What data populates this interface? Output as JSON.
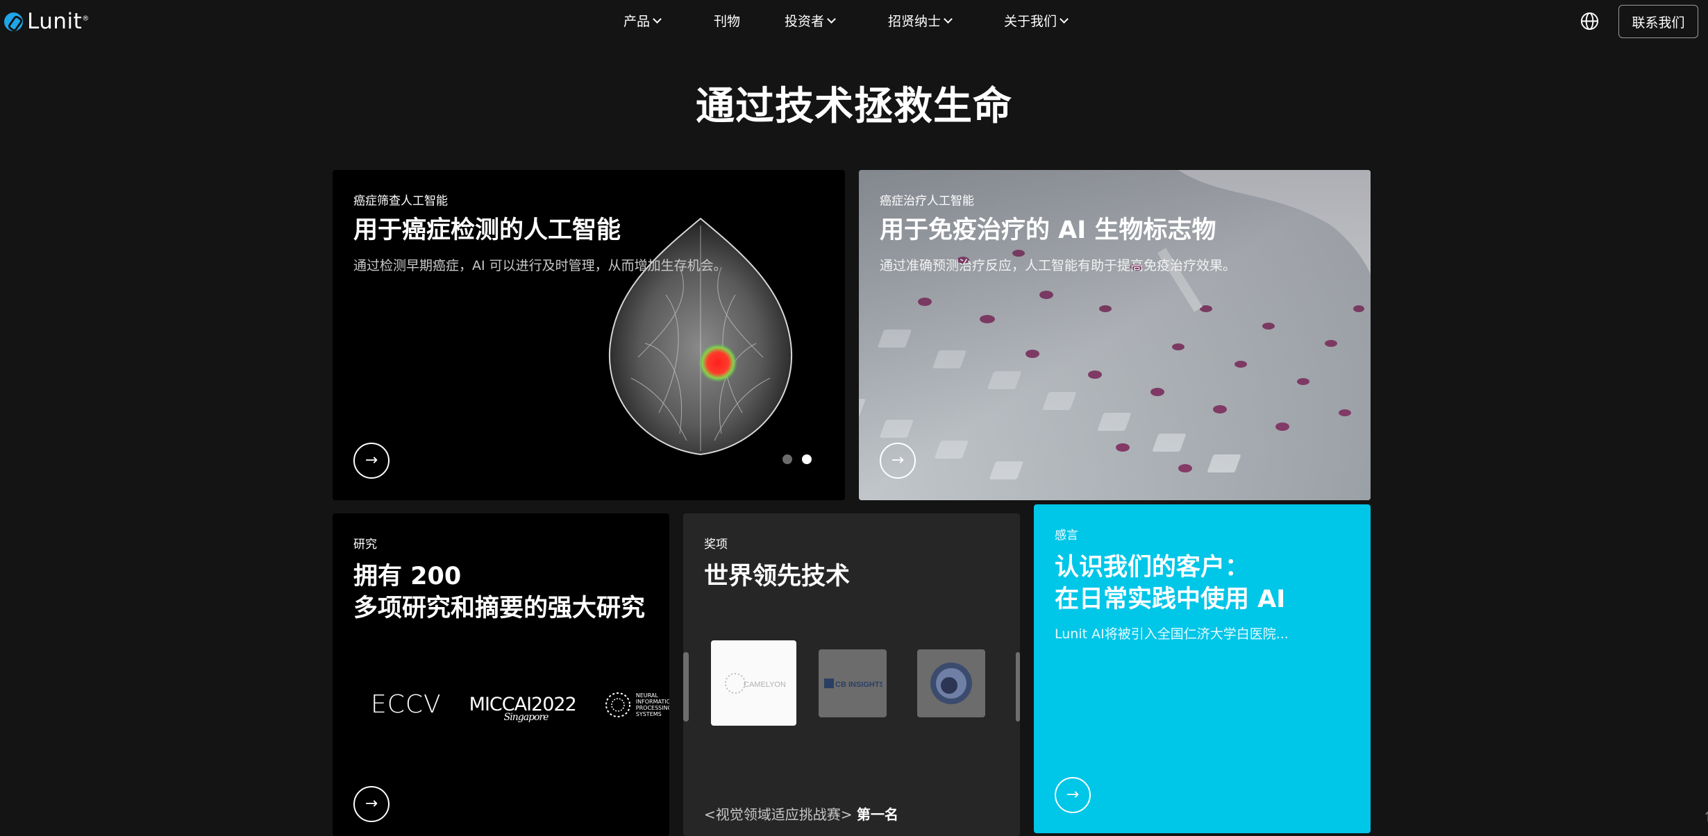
{
  "nav": {
    "logo_text": "Lunit",
    "logo_mark": "®",
    "menu": [
      {
        "label": "产品",
        "has_dropdown": true
      },
      {
        "label": "刊物",
        "has_dropdown": false
      },
      {
        "label": "投资者",
        "has_dropdown": true
      },
      {
        "label": "招贤纳士",
        "has_dropdown": true
      },
      {
        "label": "关于我们",
        "has_dropdown": true
      }
    ],
    "globe_icon": "globe-icon",
    "contact_label": "联系我们"
  },
  "hero": {
    "title": "通过技术拯救生命"
  },
  "cards": {
    "screening": {
      "kicker": "癌症筛查人工智能",
      "headline": "用于癌症检测的人工智能",
      "description": "通过检测早期癌症，AI 可以进行及时管理，从而增加生存机会。",
      "arrow_icon": "arrow-right-icon",
      "carousel": {
        "count": 2,
        "active": 2
      }
    },
    "therapy": {
      "kicker": "癌症治疗人工智能",
      "headline": "用于免疫治疗的 AI 生物标志物",
      "description": "通过准确预测治疗反应，人工智能有助于提高免疫治疗效果。",
      "arrow_icon": "arrow-right-icon"
    },
    "research": {
      "kicker": "研究",
      "headline": "拥有 200\n多项研究和摘要的强大研究",
      "logos": {
        "eccv": "ECCV",
        "miccai": "MICCAI2022",
        "miccai_sub": "Singapore",
        "neurips": "NEURAL INFORMATION PROCESSING SYSTEMS"
      },
      "arrow_icon": "arrow-right-icon"
    },
    "awards": {
      "kicker": "奖项",
      "headline": "世界领先技术",
      "logos": {
        "cameyonst": "CAMELYON17",
        "cbinsights": "CB INSIGHTS"
      },
      "caption_prefix": "<视觉领域适应挑战赛>",
      "caption_highlight": "第一名"
    },
    "testimonial": {
      "kicker": "感言",
      "headline": "认识我们的客户：\n在日常实践中使用 AI",
      "description": "Lunit AI将被引入全国仁济大学白医院...",
      "arrow_icon": "arrow-right-icon"
    }
  },
  "colors": {
    "background": "#141414",
    "accent_cyan": "#00c6e8",
    "brand_blue": "#1ea6e8"
  }
}
